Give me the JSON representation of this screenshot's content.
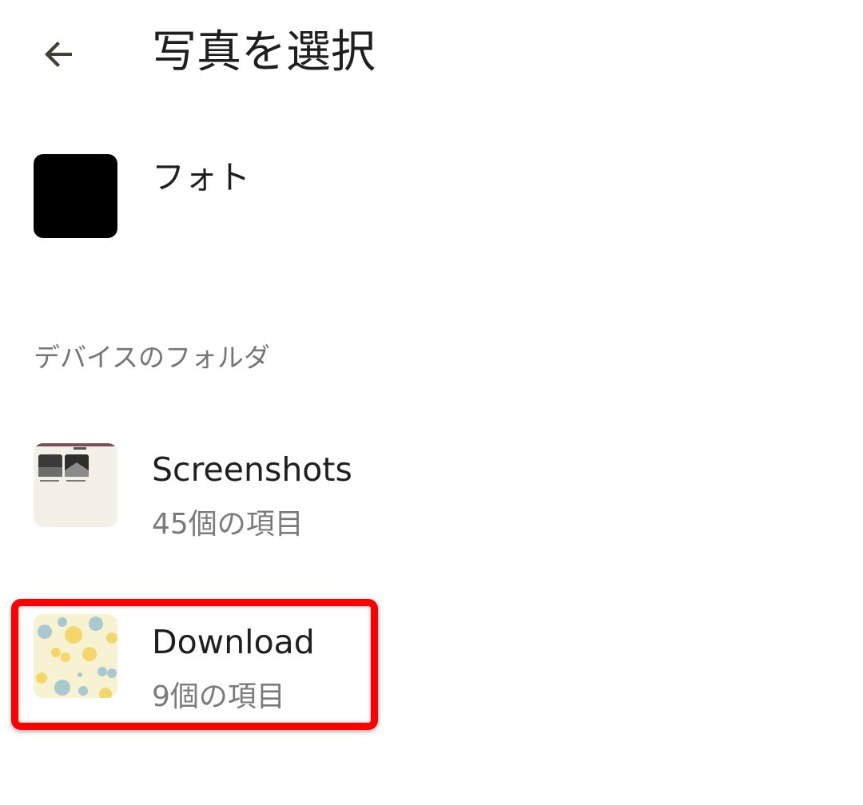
{
  "header": {
    "title": "写真を選択",
    "back_icon": "arrow-back-icon"
  },
  "photos_row": {
    "title": "フォト",
    "thumbnail_color": "#000000"
  },
  "section": {
    "header": "デバイスのフォルダ"
  },
  "folders": [
    {
      "title": "Screenshots",
      "count": "45個の項目",
      "thumbnail": "screenshots-thumbnail"
    },
    {
      "title": "Download",
      "count": "9個の項目",
      "thumbnail": "fruit-pattern-thumbnail",
      "highlighted": true
    }
  ],
  "colors": {
    "highlight": "#ff0000",
    "text_primary": "#1f1f1f",
    "text_secondary": "#757575"
  }
}
